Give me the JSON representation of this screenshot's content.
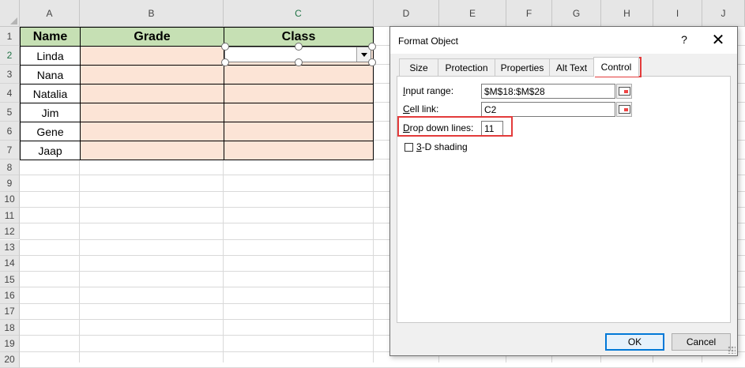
{
  "sheet": {
    "columns": [
      "A",
      "B",
      "C",
      "D",
      "E",
      "F",
      "G",
      "H",
      "I",
      "J"
    ],
    "rows": [
      "1",
      "2",
      "3",
      "4",
      "5",
      "6",
      "7",
      "8",
      "9",
      "10",
      "11",
      "12",
      "13",
      "14",
      "15",
      "16",
      "17",
      "18",
      "19",
      "20"
    ],
    "header_row": [
      "Name",
      "Grade",
      "Class"
    ],
    "names": [
      "Linda",
      "Nana",
      "Natalia",
      "Jim",
      "Gene",
      "Jaap"
    ],
    "selected_row": "2",
    "colors": {
      "header_fill": "#c6e0b4",
      "pink_fill": "#fce4d6",
      "selected_accent": "#217346"
    }
  },
  "dialog": {
    "title": "Format Object",
    "help_label": "?",
    "close_label": "✕",
    "tabs": [
      "Size",
      "Protection",
      "Properties",
      "Alt Text",
      "Control"
    ],
    "active_tab": "Control",
    "input_range_label": "Input range:",
    "input_range_value": "$M$18:$M$28",
    "cell_link_label": "Cell link:",
    "cell_link_value": "C2",
    "drop_down_lines_label": "Drop down lines:",
    "drop_down_lines_value": "11",
    "shading_label": "3-D shading",
    "ok_label": "OK",
    "cancel_label": "Cancel",
    "highlight_color": "#e33b3b"
  }
}
